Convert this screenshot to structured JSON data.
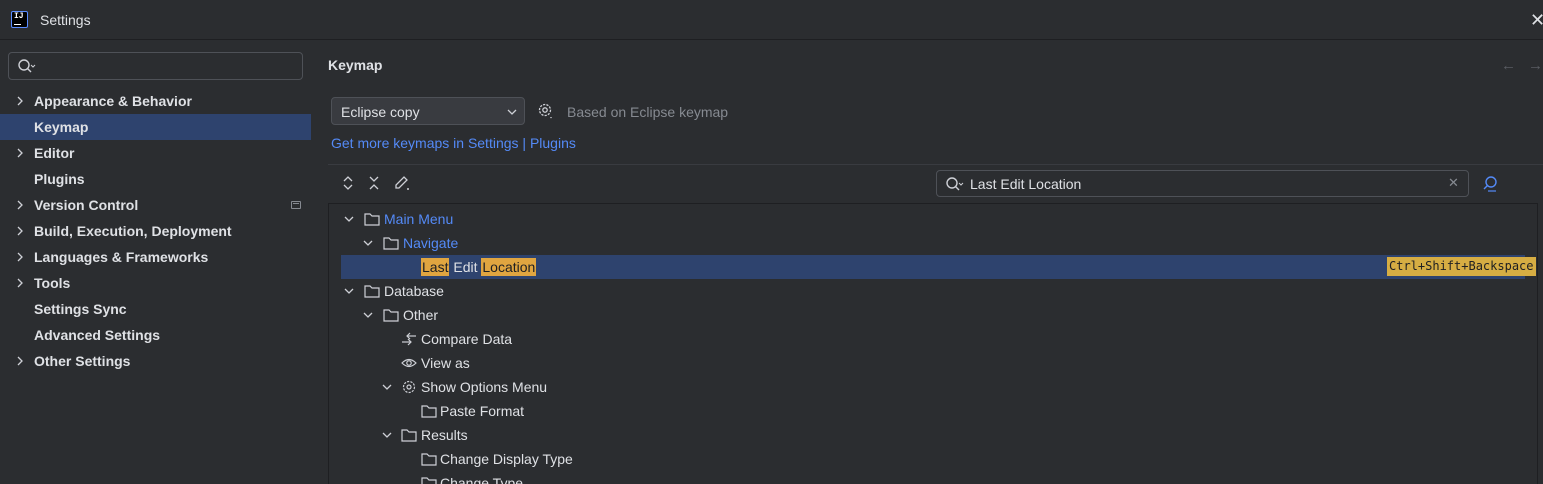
{
  "window": {
    "title": "Settings",
    "logo_text": "IJ"
  },
  "sidebar": {
    "search": {
      "value": "",
      "placeholder": ""
    },
    "items": [
      {
        "label": "Appearance & Behavior",
        "expandable": true,
        "selected": false
      },
      {
        "label": "Keymap",
        "expandable": false,
        "selected": true
      },
      {
        "label": "Editor",
        "expandable": true,
        "selected": false
      },
      {
        "label": "Plugins",
        "expandable": false,
        "selected": false
      },
      {
        "label": "Version Control",
        "expandable": true,
        "selected": false,
        "badge": "window-icon"
      },
      {
        "label": "Build, Execution, Deployment",
        "expandable": true,
        "selected": false
      },
      {
        "label": "Languages & Frameworks",
        "expandable": true,
        "selected": false
      },
      {
        "label": "Tools",
        "expandable": true,
        "selected": false
      },
      {
        "label": "Settings Sync",
        "expandable": false,
        "selected": false
      },
      {
        "label": "Advanced Settings",
        "expandable": false,
        "selected": false
      },
      {
        "label": "Other Settings",
        "expandable": true,
        "selected": false
      }
    ]
  },
  "main": {
    "title": "Keymap",
    "keymap_select": {
      "value": "Eclipse copy"
    },
    "based_on": "Based on Eclipse keymap",
    "more_link": "Get more keymaps in Settings | Plugins",
    "filter": {
      "value": "Last Edit Location"
    },
    "tree": {
      "main_menu": "Main Menu",
      "navigate": "Navigate",
      "action_word_1": "Last",
      "action_word_2": "Edit",
      "action_word_3": "Location",
      "shortcut": "Ctrl+Shift+Backspace",
      "database": "Database",
      "other": "Other",
      "compare_data": "Compare Data",
      "view_as": "View as",
      "show_options_menu": "Show Options Menu",
      "paste_format": "Paste Format",
      "results": "Results",
      "change_display_type": "Change Display Type",
      "change_type": "Change Type"
    }
  },
  "colors": {
    "background": "#2b2d30",
    "selection": "#2e436e",
    "link": "#548af7",
    "highlight": "#e0a540",
    "shortcut_badge": "#d6ad43"
  }
}
